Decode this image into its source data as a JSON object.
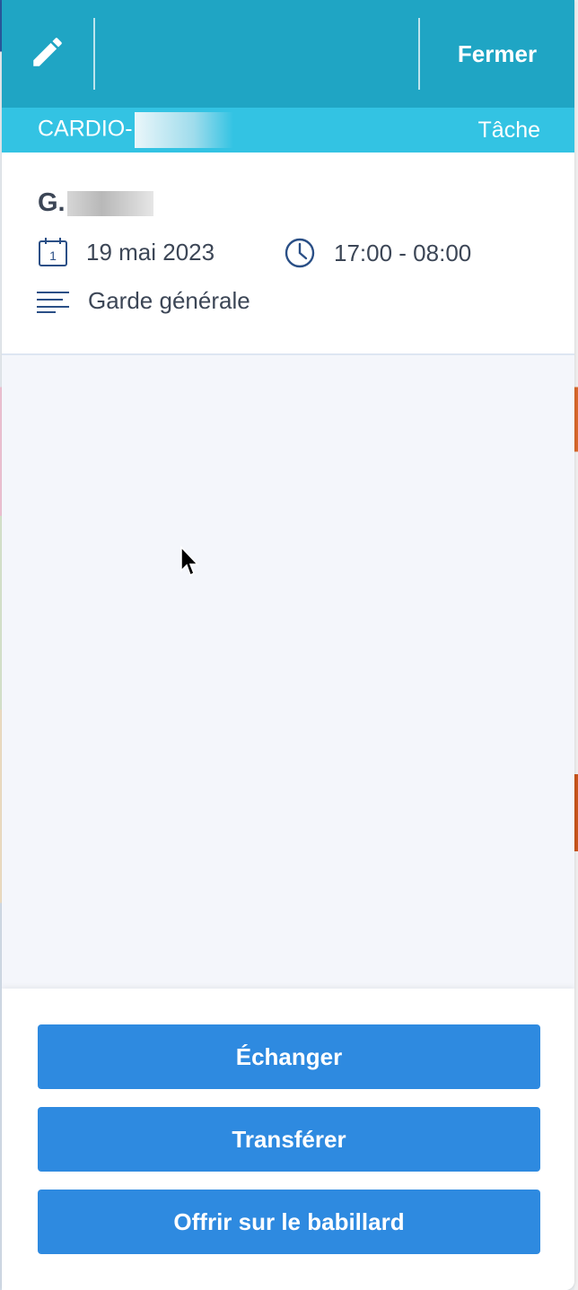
{
  "header": {
    "edit_icon": "pencil-icon",
    "close_label": "Fermer"
  },
  "subheader": {
    "service": "CARDIO-",
    "type": "Tâche"
  },
  "shift": {
    "person": "G.",
    "date": "19 mai 2023",
    "time": "17:00 - 08:00",
    "description": "Garde générale",
    "icons": {
      "date": "calendar-icon",
      "time": "clock-icon",
      "description": "lines-icon"
    }
  },
  "actions": {
    "exchange_label": "Échanger",
    "transfer_label": "Transférer",
    "offer_label": "Offrir sur le babillard"
  },
  "colors": {
    "topbar": "#1fa5c4",
    "subbar": "#33c3e3",
    "button": "#2e8ae0",
    "text": "#3c4656",
    "icon": "#2a4f86"
  }
}
